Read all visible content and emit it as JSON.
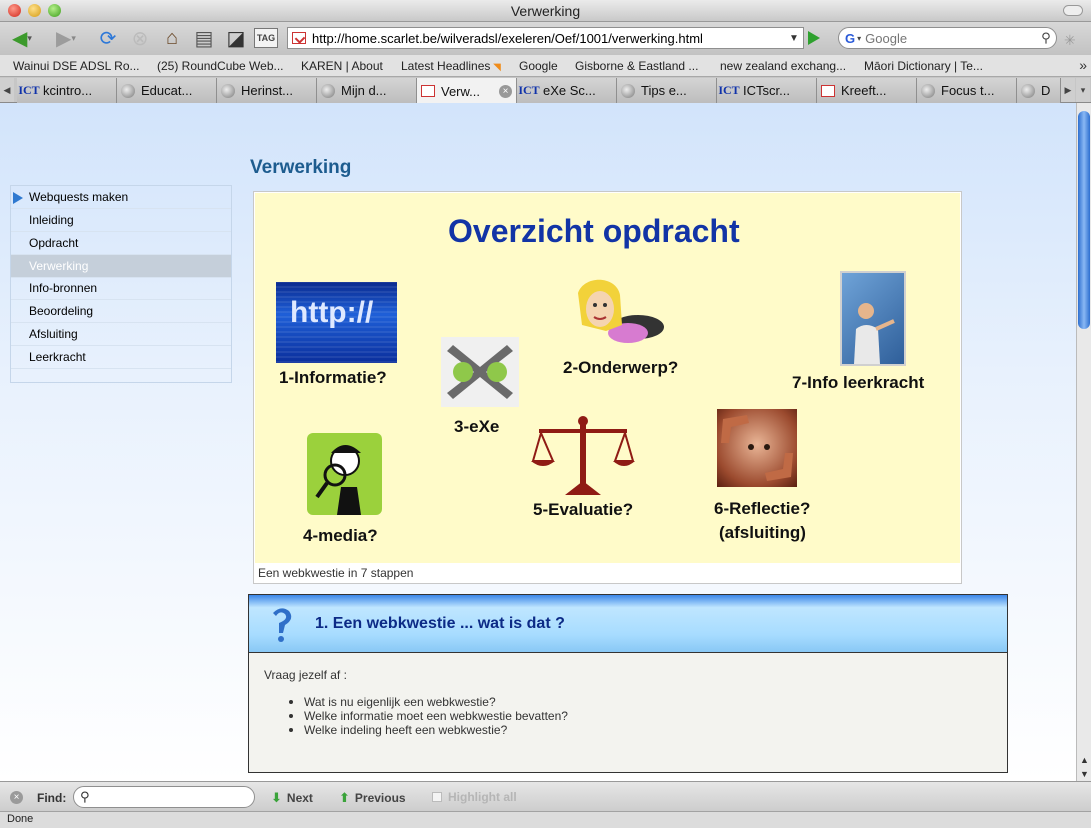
{
  "window": {
    "title": "Verwerking"
  },
  "toolbar": {
    "url": "http://home.scarlet.be/wilveradsl/exeleren/Oef/1001/verwerking.html",
    "search_placeholder": "Google",
    "tag_label": "TAG",
    "search_engine_letter": "G"
  },
  "bookmarks": [
    "Wainui DSE ADSL Ro...",
    "(25) RoundCube Web...",
    "KAREN | About",
    "Latest Headlines",
    "Google",
    "Gisborne & Eastland ...",
    "new zealand exchang...",
    "Māori Dictionary | Te..."
  ],
  "tabs": [
    {
      "label": "kcintro...",
      "icon": "ICT"
    },
    {
      "label": "Educat...",
      "icon": "globe"
    },
    {
      "label": "Herinst...",
      "icon": "globe"
    },
    {
      "label": "Mijn d...",
      "icon": "globe"
    },
    {
      "label": "Verw...",
      "icon": "red"
    },
    {
      "label": "eXe Sc...",
      "icon": "ICT"
    },
    {
      "label": "Tips e...",
      "icon": "globe"
    },
    {
      "label": "ICTscr...",
      "icon": "ICT"
    },
    {
      "label": "Kreeft...",
      "icon": "red"
    },
    {
      "label": "Focus t...",
      "icon": "globe"
    },
    {
      "label": "D",
      "icon": "globe"
    }
  ],
  "page": {
    "title": "Verwerking",
    "nav": [
      "Webquests maken",
      "Inleiding",
      "Opdracht",
      "Verwerking",
      "Info-bronnen",
      "Beoordeling",
      "Afsluiting",
      "Leerkracht"
    ],
    "active_nav": "Verwerking",
    "poster": {
      "title": "Overzicht opdracht",
      "http_text": "http://",
      "labels": {
        "informatie": "1-Informatie?",
        "onderwerp": "2-Onderwerp?",
        "exe": "3-eXe",
        "media": "4-media?",
        "evaluatie": "5-Evaluatie?",
        "reflectie_1": "6-Reflectie?",
        "reflectie_2": "(afsluiting)",
        "info_leerkracht": "7-Info leerkracht"
      }
    },
    "caption": "Een webkwestie in 7 stappen",
    "idevice": {
      "title": "1. Een webkwestie ... wat is dat ?",
      "intro": "Vraag jezelf af :",
      "questions": [
        "Wat is nu eigenlijk een webkwestie?",
        "Welke informatie moet een webkwestie bevatten?",
        "Welke indeling heeft een webkwestie?"
      ]
    }
  },
  "findbar": {
    "label": "Find:",
    "next": "Next",
    "previous": "Previous",
    "highlight": "Highlight all",
    "value": ""
  },
  "status": "Done",
  "colors": {
    "page_title": "#1d5c8f",
    "poster_bg": "#fffbc9",
    "poster_title": "#1234a6",
    "nav_active": "#c5cfda"
  }
}
